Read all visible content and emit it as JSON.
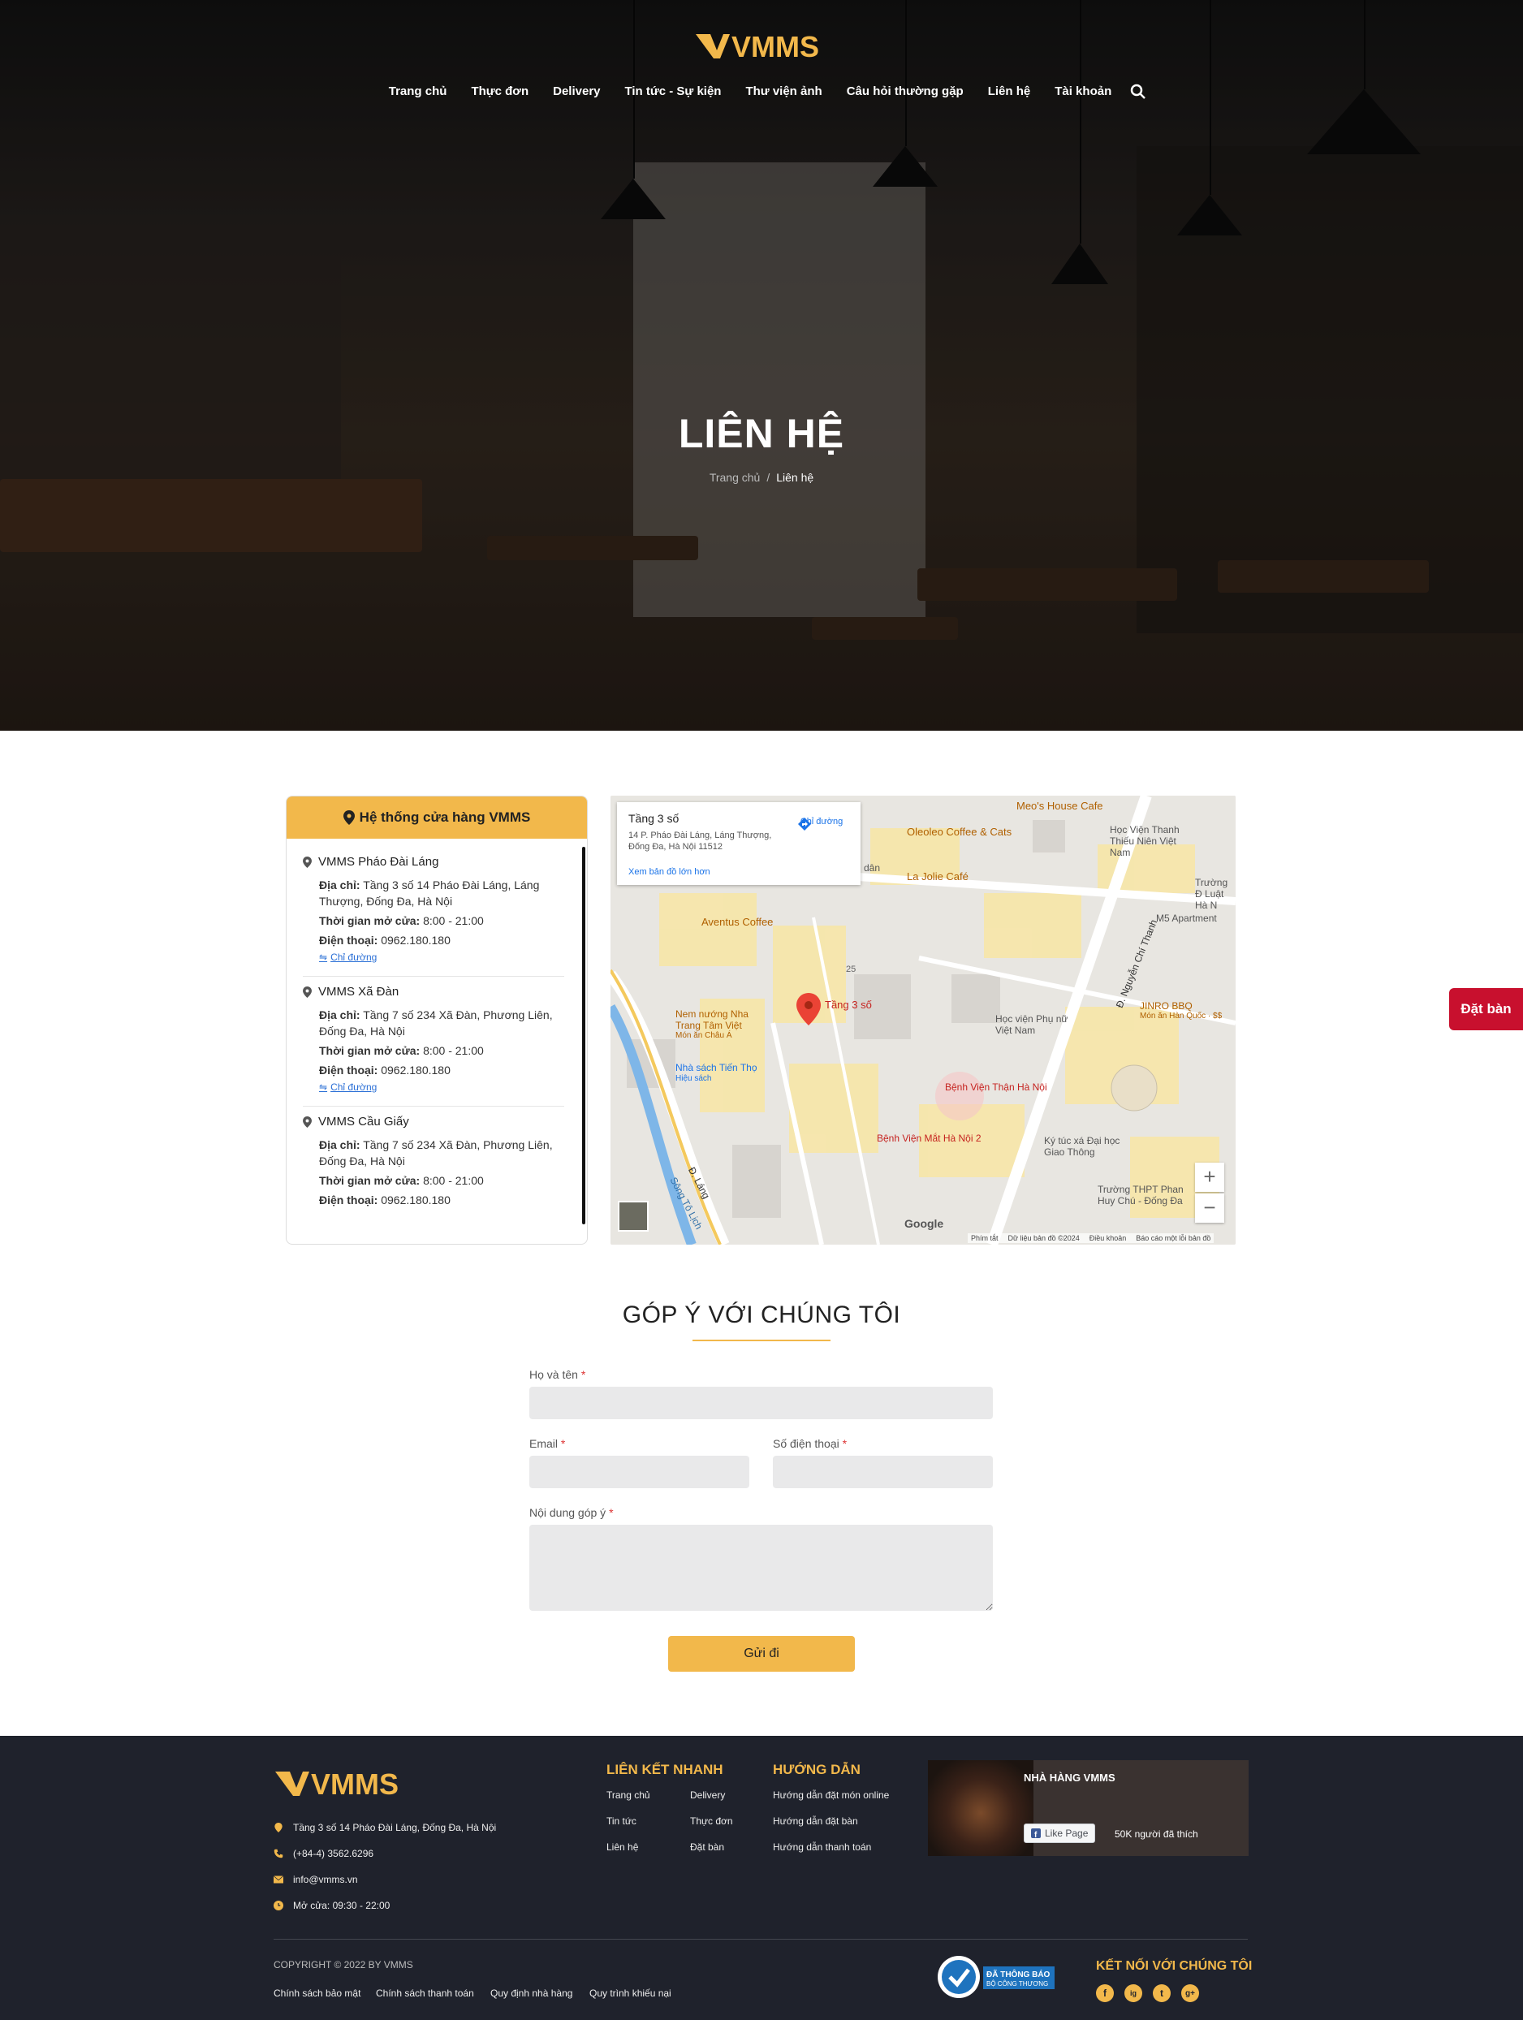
{
  "brand": {
    "logo_text": "VMMS",
    "accent": "#f2b84b",
    "dark": "#1f222c",
    "red": "#c8102e"
  },
  "nav": {
    "items": [
      "Trang chủ",
      "Thực đơn",
      "Delivery",
      "Tin tức - Sự kiện",
      "Thư viện ảnh",
      "Câu hỏi thường gặp",
      "Liên hệ",
      "Tài khoản"
    ]
  },
  "hero": {
    "title": "LIÊN HỆ",
    "breadcrumb": {
      "home": "Trang chủ",
      "sep": "/",
      "current": "Liên hệ"
    }
  },
  "stores": {
    "heading": "Hệ thống cửa hàng VMMS",
    "address_label": "Địa chỉ:",
    "hours_label": "Thời gian mở cửa:",
    "phone_label": "Điện thoại:",
    "directions": "Chỉ đường",
    "items": [
      {
        "name": "VMMS Pháo Đài Láng",
        "address": "Tầng 3 số 14 Pháo Đài Láng, Láng Thượng, Đống Đa, Hà Nội",
        "hours": "8:00 - 21:00",
        "phone": "0962.180.180"
      },
      {
        "name": "VMMS Xã Đàn",
        "address": "Tầng 7 số 234 Xã Đàn, Phương Liên, Đống Đa, Hà Nội",
        "hours": "8:00 - 21:00",
        "phone": "0962.180.180"
      },
      {
        "name": "VMMS Cầu Giấy",
        "address": "Tầng 7 số 234 Xã Đàn, Phương Liên, Đống Đa, Hà Nội",
        "hours": "8:00 - 21:00",
        "phone": "0962.180.180"
      }
    ]
  },
  "map": {
    "card_title": "Tầng 3 số",
    "card_address": "14 P. Pháo Đài Láng, Láng Thượng, Đống Đa, Hà Nội 11512",
    "card_link": "Xem bản đồ lớn hơn",
    "card_directions": "Chỉ đường",
    "pin_label": "Tầng 3 số",
    "places": [
      "Meo's House Cafe",
      "Oleoleo Coffee & Cats",
      "La Jolie Café",
      "Aventus Coffee",
      "Học Viện Thanh Thiếu Niên Việt Nam",
      "Trường Đ Luật Hà N",
      "M5 Apartment",
      "JINRO BBQ",
      "Món ăn Hàn Quốc · $$",
      "Học viện Phụ nữ Việt Nam",
      "Nem nướng Nha Trang Tâm Việt",
      "Món ăn Châu Á",
      "Nhà sách Tiến Thọ",
      "Hiệu sách",
      "Bệnh Viện Thận Hà Nội",
      "Bệnh Viện Mắt Hà Nội 2",
      "Ký túc xá Đại học Giao Thông",
      "Trường THPT Phan Huy Chú - Đống Đa",
      "Đ. Láng",
      "Sông Tô Lịch",
      "Đ. Nguyễn Chí Thanh",
      "dân",
      "25",
      "Google"
    ],
    "zoom_in": "+",
    "zoom_out": "−",
    "footer": [
      "Phím tắt",
      "Dữ liệu bản đồ ©2024",
      "Điều khoản",
      "Báo cáo một lỗi bản đồ"
    ]
  },
  "feedback": {
    "title": "GÓP Ý VỚI CHÚNG TÔI",
    "name_label": "Họ và tên",
    "email_label": "Email",
    "phone_label": "Số điện thoại",
    "content_label": "Nội dung góp ý",
    "required": "*",
    "submit": "Gửi đi"
  },
  "float_button": "Đặt bàn",
  "footer": {
    "address": "Tầng 3 số 14 Pháo Đài Láng, Đống Đa, Hà Nội",
    "phone": "(+84-4) 3562.6296",
    "email": "info@vmms.vn",
    "hours": "Mở cửa: 09:30 - 22:00",
    "quick_title": "LIÊN KẾT NHANH",
    "quick_links": [
      "Trang chủ",
      "Delivery",
      "Tin tức",
      "Thực đơn",
      "Liên hệ",
      "Đặt bàn"
    ],
    "guide_title": "HƯỚNG DẪN",
    "guide_links": [
      "Hướng dẫn đặt món online",
      "Hướng dẫn đặt bàn",
      "Hướng dẫn thanh toán"
    ],
    "fb": {
      "title": "NHÀ HÀNG VMMS",
      "like": "Like Page",
      "count": "50K người đã thích"
    },
    "copyright": "COPYRIGHT © 2022 BY VMMS",
    "policies": [
      "Chính sách bảo mật",
      "Chính sách thanh toán",
      "Quy định nhà hàng",
      "Quy trình khiếu nại"
    ],
    "badge": {
      "line1": "ĐÃ THÔNG BÁO",
      "line2": "BỘ CÔNG THƯƠNG"
    },
    "connect": "KẾT NỐI VỚI CHÚNG TÔI",
    "social": [
      "f",
      "ig",
      "t",
      "g+"
    ]
  }
}
